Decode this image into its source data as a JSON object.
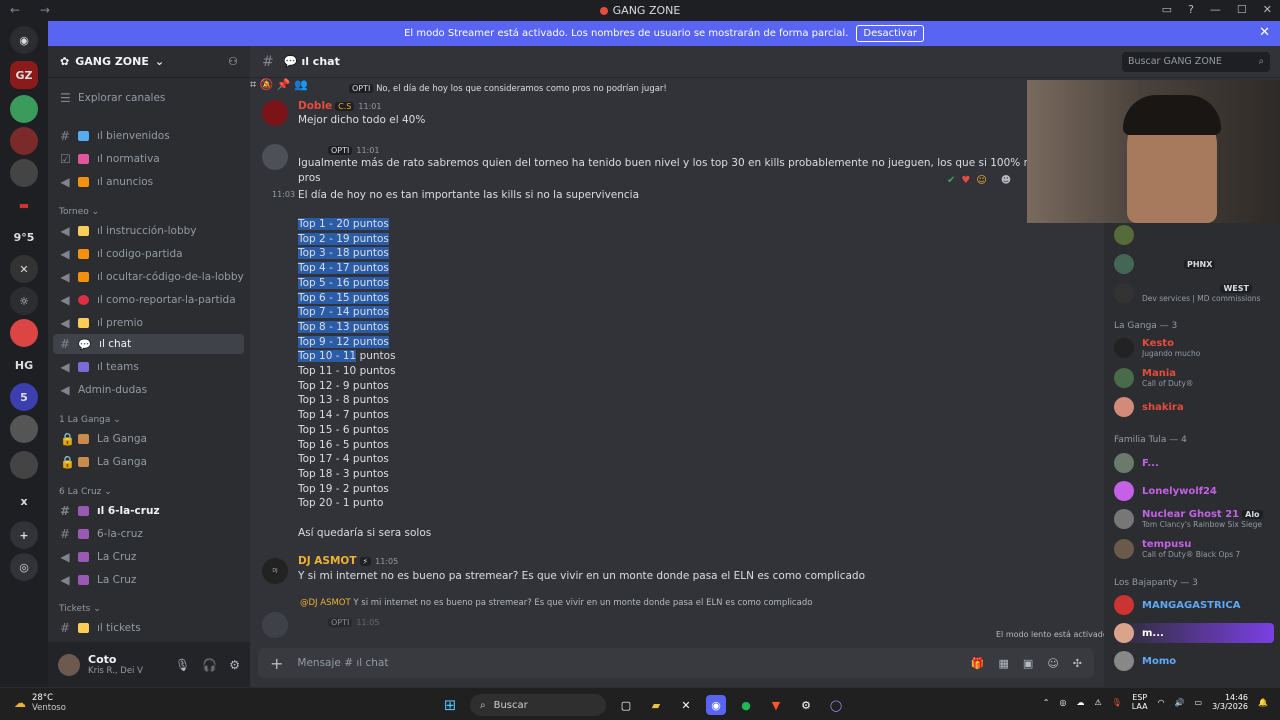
{
  "window": {
    "title": "GANG ZONE"
  },
  "banner": {
    "text": "El modo Streamer está activado. Los nombres de usuario se mostrarán de forma parcial.",
    "button": "Desactivar"
  },
  "server": {
    "name": "GANG ZONE",
    "explore": "Explorar canales"
  },
  "channels": [
    {
      "label": "ıl bienvenidos",
      "icon": "hash"
    },
    {
      "label": "ıl normativa",
      "icon": "check"
    },
    {
      "label": "ıl anuncios",
      "icon": "megaphone"
    }
  ],
  "cat_torneo": "Torneo",
  "torneo_channels": [
    {
      "label": "ıl instrucción-lobby"
    },
    {
      "label": "ıl codigo-partida"
    },
    {
      "label": "ıl ocultar-código-de-la-lobby"
    },
    {
      "label": "ıl como-reportar-la-partida"
    },
    {
      "label": "ıl premio"
    },
    {
      "label": "ıl chat"
    },
    {
      "label": "ıl teams"
    },
    {
      "label": "Admin-dudas"
    }
  ],
  "cat_ganga": "1 La Ganga",
  "ganga_channels": [
    "La Ganga",
    "La Ganga"
  ],
  "cat_cruz": "6 La Cruz",
  "cruz_channels": [
    "ıl 6-la-cruz",
    "6-la-cruz",
    "La Cruz",
    "La Cruz"
  ],
  "cat_tickets": "Tickets",
  "tickets_channel": "ıl tickets",
  "user": {
    "name": "Coto",
    "status": "Kris R., Dei V"
  },
  "chat_header": {
    "channel": "ıl chat",
    "search_placeholder": "Buscar GANG ZONE"
  },
  "messages": {
    "reply1_author": "OPTI",
    "reply1_text": "No, el día de hoy los que consideramos como pros no podrían jugar!",
    "m1_author": "Doble",
    "m1_tag": "C.S",
    "m1_time": "11:01",
    "m1_text": "Mejor dicho todo el 40%",
    "m2_author": "OPTI",
    "m2_time": "11:01",
    "m2_text1": "Igualmente más de rato sabremos quien del torneo ha tenido buen nivel y los top 30 en kills probablemente no jueguen, los que si 100% no juegan son los que cons",
    "m2_text2": "pros",
    "m3_time": "11:03",
    "m3_text": "El día de hoy no es tan importante las kills si no la supervivencia",
    "top_list": [
      "Top 1 - 20 puntos",
      "Top 2 - 19 puntos",
      "Top 3 - 18 puntos",
      "Top 4 - 17 puntos",
      "Top 5 - 16 puntos",
      "Top 6 - 15 puntos",
      "Top 7 - 14 puntos",
      "Top 8 - 13 puntos",
      "Top 9 - 12 puntos"
    ],
    "top10_a": "Top 10 - 11",
    "top10_b": " puntos",
    "top_rest": [
      "Top 11 - 10 puntos",
      "Top 12 - 9 puntos",
      "Top 13 - 8 puntos",
      "Top 14 - 7 puntos",
      "Top 15 - 6 puntos",
      "Top 16 - 5 puntos",
      "Top 17 - 4 puntos",
      "Top 18 - 3 puntos",
      "Top 19 - 2 puntos",
      "Top 20 - 1 punto"
    ],
    "closing": "Así quedaría si sera solos",
    "m4_author": "DJ ASMOT",
    "m4_time": "11:05",
    "m4_text": "Y si mi internet no es bueno pa stremear? Es que vivir en un monte donde pasa el ELN es como complicado",
    "reply2_author": "@DJ ASMOT",
    "reply2_text": "Y si mi internet no es bueno pa stremear? Es que vivir en un monte donde pasa el ELN es como complicado",
    "m5_author": "OPTI",
    "m5_time": "11:05",
    "slow_mode": "El modo lento está activado."
  },
  "composer": {
    "placeholder": "Mensaje # ıl chat"
  },
  "members": {
    "top": [
      {
        "name": "PHNX"
      },
      {
        "name": "WEST",
        "sub": "Dev services | MD commissions"
      }
    ],
    "cat1": "La Ganga — 3",
    "ganga": [
      {
        "name": "Kesto",
        "sub": "Jugando mucho",
        "color": "#e74c3c"
      },
      {
        "name": "Mania",
        "sub": "Call of Duty®",
        "color": "#e74c3c"
      },
      {
        "name": "shakira",
        "sub": "",
        "color": "#e74c3c"
      }
    ],
    "cat2": "Familia Tula — 4",
    "tula": [
      {
        "name": "F...",
        "sub": "",
        "color": "#c561e6"
      },
      {
        "name": "Lonelywolf24",
        "sub": "",
        "color": "#c561e6"
      },
      {
        "name": "Nuclear Ghost 21",
        "sub": "Tom Clancy's Rainbow Six Siege",
        "color": "#c561e6",
        "tag": "Alo"
      },
      {
        "name": "tempusu",
        "sub": "Call of Duty® Black Ops 7",
        "color": "#c561e6"
      }
    ],
    "cat3": "Los Bajapanty — 3",
    "baja": [
      {
        "name": "MANGAGASTRICA",
        "color": "#5fa8f5"
      },
      {
        "name": "m...",
        "color": "#fff"
      },
      {
        "name": "Momo",
        "color": "#5fa8f5"
      }
    ]
  },
  "taskbar": {
    "temp": "28°C",
    "weather": "Ventoso",
    "search": "Buscar",
    "lang": "ESP",
    "lang2": "LAA",
    "time": "14:46",
    "date": "3/3/2026"
  },
  "colors": {
    "accent": "#5865f2",
    "highlight": "#2a5ca8",
    "gold": "#f0b232"
  }
}
